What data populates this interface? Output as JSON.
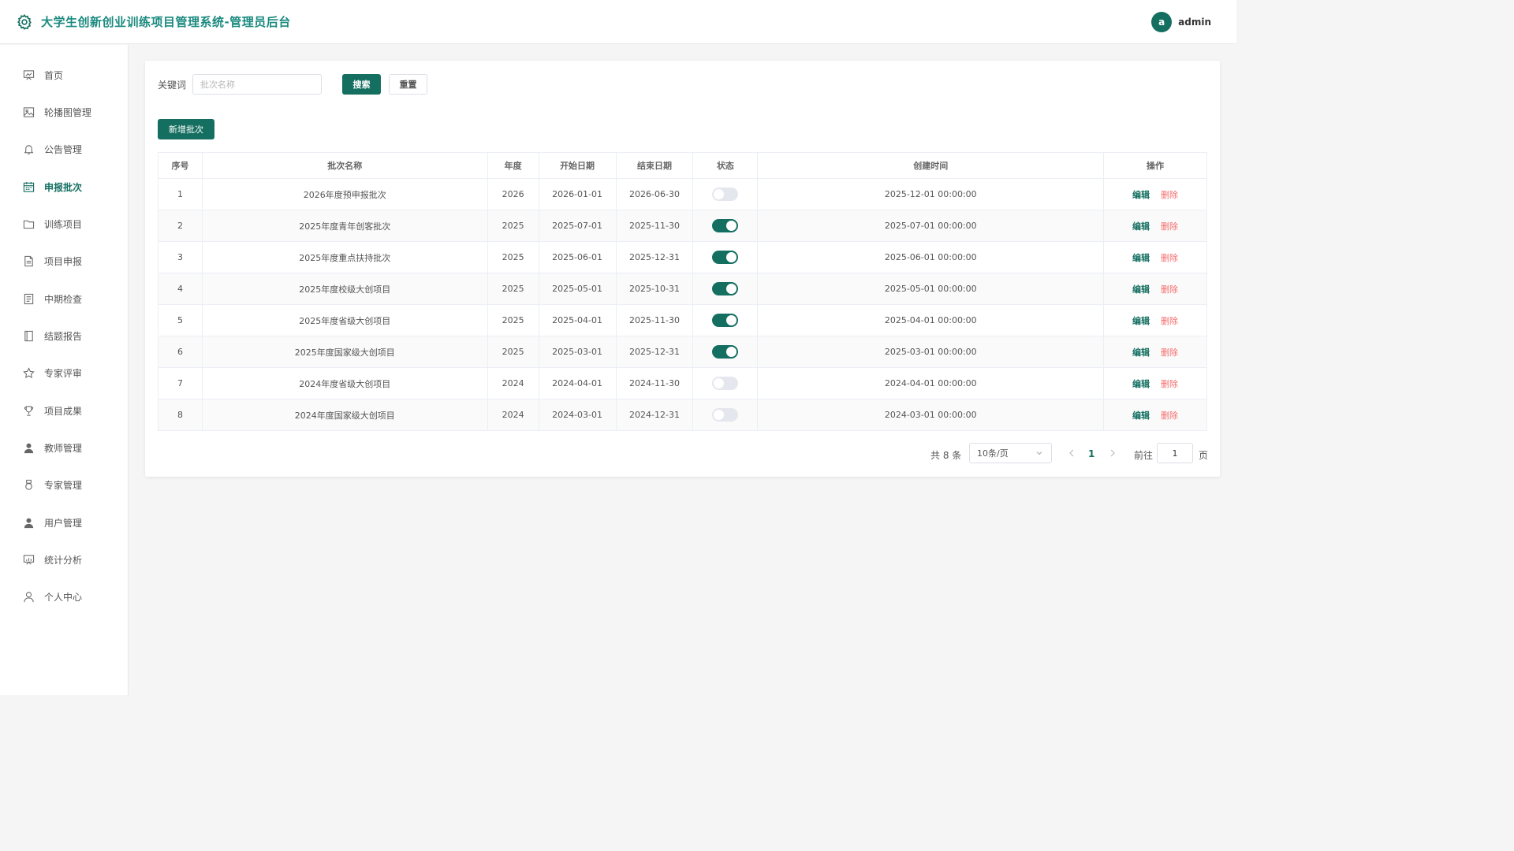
{
  "header": {
    "title": "大学生创新创业训练项目管理系统-管理员后台",
    "avatar_letter": "a",
    "username": "admin"
  },
  "sidebar": {
    "items": [
      {
        "label": "首页",
        "icon": "dashboard-icon"
      },
      {
        "label": "轮播图管理",
        "icon": "image-icon"
      },
      {
        "label": "公告管理",
        "icon": "bell-icon"
      },
      {
        "label": "申报批次",
        "icon": "calendar-icon",
        "active": true
      },
      {
        "label": "训练项目",
        "icon": "folder-icon"
      },
      {
        "label": "项目申报",
        "icon": "document-icon"
      },
      {
        "label": "中期检查",
        "icon": "checklist-icon"
      },
      {
        "label": "结题报告",
        "icon": "notebook-icon"
      },
      {
        "label": "专家评审",
        "icon": "star-icon"
      },
      {
        "label": "项目成果",
        "icon": "trophy-icon"
      },
      {
        "label": "教师管理",
        "icon": "user-filled-icon"
      },
      {
        "label": "专家管理",
        "icon": "medal-icon"
      },
      {
        "label": "用户管理",
        "icon": "user-filled-icon"
      },
      {
        "label": "统计分析",
        "icon": "chart-board-icon"
      },
      {
        "label": "个人中心",
        "icon": "user-outline-icon"
      }
    ]
  },
  "search": {
    "label": "关键词",
    "placeholder": "批次名称",
    "value": "",
    "search_label": "搜索",
    "reset_label": "重置"
  },
  "toolbar": {
    "add_label": "新增批次"
  },
  "table": {
    "columns": [
      "序号",
      "批次名称",
      "年度",
      "开始日期",
      "结束日期",
      "状态",
      "创建时间",
      "操作"
    ],
    "edit_label": "编辑",
    "delete_label": "删除",
    "rows": [
      {
        "index": "1",
        "name": "2026年度预申报批次",
        "year": "2026",
        "start": "2026-01-01",
        "end": "2026-06-30",
        "enabled": false,
        "created": "2025-12-01 00:00:00"
      },
      {
        "index": "2",
        "name": "2025年度青年创客批次",
        "year": "2025",
        "start": "2025-07-01",
        "end": "2025-11-30",
        "enabled": true,
        "created": "2025-07-01 00:00:00"
      },
      {
        "index": "3",
        "name": "2025年度重点扶持批次",
        "year": "2025",
        "start": "2025-06-01",
        "end": "2025-12-31",
        "enabled": true,
        "created": "2025-06-01 00:00:00"
      },
      {
        "index": "4",
        "name": "2025年度校级大创项目",
        "year": "2025",
        "start": "2025-05-01",
        "end": "2025-10-31",
        "enabled": true,
        "created": "2025-05-01 00:00:00"
      },
      {
        "index": "5",
        "name": "2025年度省级大创项目",
        "year": "2025",
        "start": "2025-04-01",
        "end": "2025-11-30",
        "enabled": true,
        "created": "2025-04-01 00:00:00"
      },
      {
        "index": "6",
        "name": "2025年度国家级大创项目",
        "year": "2025",
        "start": "2025-03-01",
        "end": "2025-12-31",
        "enabled": true,
        "created": "2025-03-01 00:00:00"
      },
      {
        "index": "7",
        "name": "2024年度省级大创项目",
        "year": "2024",
        "start": "2024-04-01",
        "end": "2024-11-30",
        "enabled": false,
        "created": "2024-04-01 00:00:00"
      },
      {
        "index": "8",
        "name": "2024年度国家级大创项目",
        "year": "2024",
        "start": "2024-03-01",
        "end": "2024-12-31",
        "enabled": false,
        "created": "2024-03-01 00:00:00"
      }
    ]
  },
  "pagination": {
    "total_text": "共 8 条",
    "page_size": "10条/页",
    "current_page": "1",
    "goto_label": "前往",
    "goto_value": "1",
    "page_suffix": "页"
  },
  "colors": {
    "primary": "#146f61",
    "title": "#1a8a7f",
    "danger": "#f56c6c",
    "switch_off": "#e4e7ed"
  }
}
